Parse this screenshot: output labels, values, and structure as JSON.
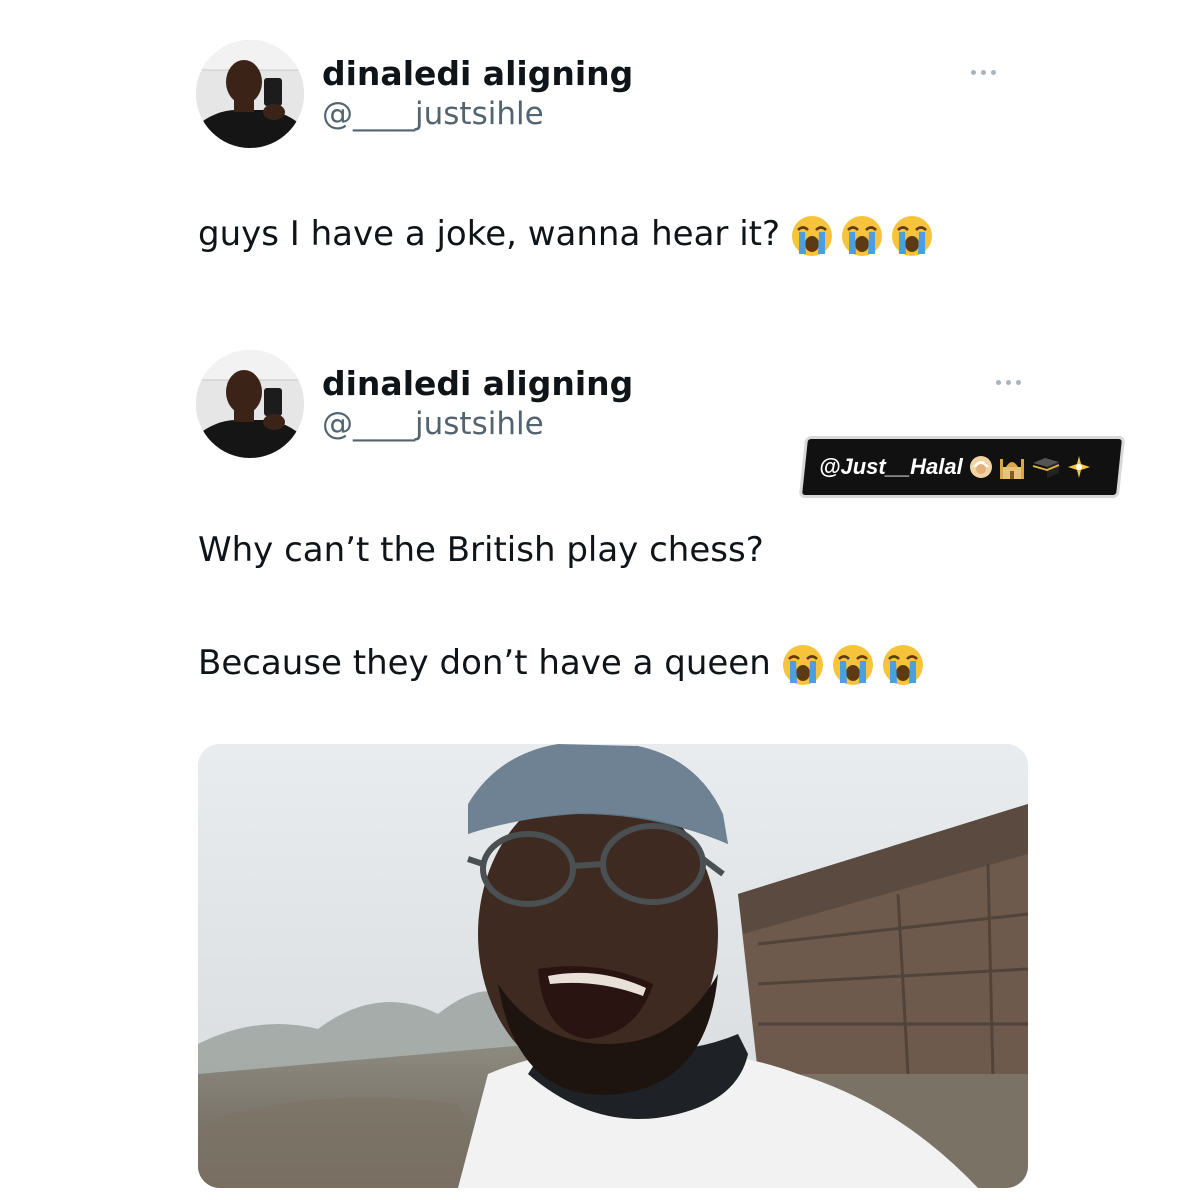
{
  "tweets": [
    {
      "display_name": "dinaledi aligning",
      "handle": "@____justsihle",
      "text": "guys I have a joke, wanna hear it?",
      "emojis": [
        "loudly-crying-face",
        "loudly-crying-face",
        "loudly-crying-face"
      ]
    },
    {
      "display_name": "dinaledi aligning",
      "handle": "@____justsihle",
      "text_line_1": "Why can’t the British play chess?",
      "text_line_2": "Because they don’t have a queen",
      "emojis": [
        "loudly-crying-face",
        "loudly-crying-face",
        "loudly-crying-face"
      ],
      "media": "photo-man-laughing-outdoors"
    }
  ],
  "watermark": {
    "text": "@Just__Halal",
    "icons": [
      "person-icon",
      "mosque-icon",
      "kaaba-icon",
      "sparkle-icon"
    ]
  },
  "colors": {
    "text_primary": "#0f1419",
    "text_secondary": "#536471",
    "more_dots": "#a9b4bd",
    "emoji_face": "#f7c33a",
    "emoji_tears": "#4a9fe3"
  }
}
